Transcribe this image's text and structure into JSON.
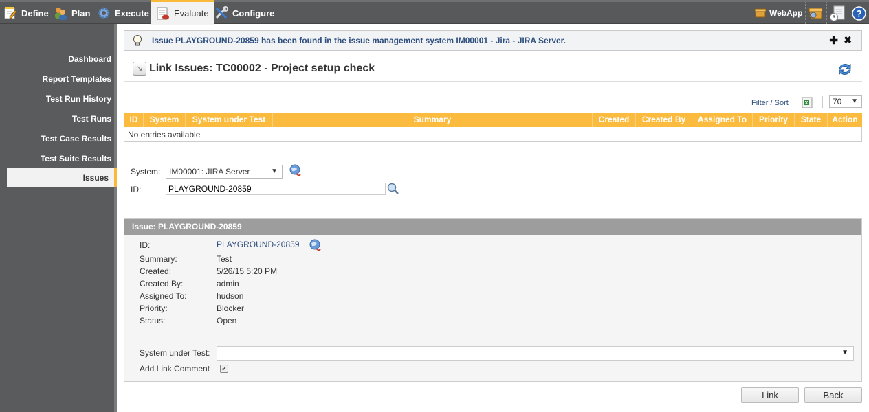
{
  "topnav": {
    "items": [
      {
        "label": "Define",
        "icon": "notepad-icon"
      },
      {
        "label": "Plan",
        "icon": "users-icon"
      },
      {
        "label": "Execute",
        "icon": "gear-icon"
      },
      {
        "label": "Evaluate",
        "icon": "report-icon",
        "active": true
      },
      {
        "label": "Configure",
        "icon": "tools-icon"
      }
    ],
    "right": {
      "webapp_label": "WebApp",
      "icons": [
        "box-search-icon",
        "document-clock-icon",
        "help-icon"
      ]
    }
  },
  "sidebar": {
    "items": [
      {
        "label": "Dashboard"
      },
      {
        "label": "Report Templates"
      },
      {
        "label": "Test Run History"
      },
      {
        "label": "Test Runs"
      },
      {
        "label": "Test Case Results"
      },
      {
        "label": "Test Suite Results"
      },
      {
        "label": "Issues",
        "active": true
      }
    ]
  },
  "notice": {
    "text": "Issue PLAYGROUND-20859 has been found in the issue management system IM00001 - Jira - JIRA Server.",
    "expand_symbol": "✚",
    "close_symbol": "✖"
  },
  "page": {
    "title": "Link Issues: TC00002 - Project setup check"
  },
  "grid_toolbar": {
    "filter_sort": "Filter / Sort",
    "page_size": "70"
  },
  "grid": {
    "columns": [
      "ID",
      "System",
      "System under Test",
      "Summary",
      "Created",
      "Created By",
      "Assigned To",
      "Priority",
      "State",
      "Action"
    ],
    "empty_text": "No entries available"
  },
  "search": {
    "system_label": "System:",
    "system_value": "IM00001: JIRA Server",
    "id_label": "ID:",
    "id_value": "PLAYGROUND-20859"
  },
  "issue": {
    "header": "Issue: PLAYGROUND-20859",
    "fields": [
      {
        "label": "ID:",
        "value": "PLAYGROUND-20859"
      },
      {
        "label": "Summary:",
        "value": "Test"
      },
      {
        "label": "Created:",
        "value": "5/26/15 5:20 PM"
      },
      {
        "label": "Created By:",
        "value": "admin"
      },
      {
        "label": "Assigned To:",
        "value": "hudson"
      },
      {
        "label": "Priority:",
        "value": "Blocker"
      },
      {
        "label": "Status:",
        "value": "Open"
      }
    ],
    "sut_label": "System under Test:",
    "sut_value": "",
    "comment_label": "Add Link Comment",
    "comment_checked": true
  },
  "actions": {
    "link": "Link",
    "back": "Back"
  },
  "colors": {
    "accent": "#fbbb3f",
    "topbar": "#58595b",
    "link": "#2f4f7f"
  }
}
